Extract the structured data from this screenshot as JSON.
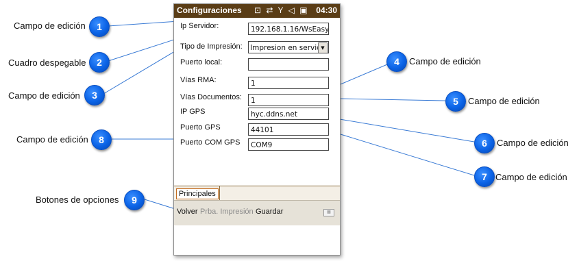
{
  "window": {
    "title": "Configuraciones",
    "status_icons": "⊡ ⇄ Y ◁ ▣",
    "time": "04:30"
  },
  "fields": [
    {
      "label": "Ip Servidor:",
      "value": "192.168.1.16/WsEasy"
    },
    {
      "label": "Tipo de Impresión:",
      "value": "Impresion en servido",
      "type": "select"
    },
    {
      "label": "Puerto local:",
      "value": ""
    },
    {
      "label": "Vías RMA:",
      "value": "1"
    },
    {
      "label": "Vías Documentos:",
      "value": "1"
    },
    {
      "label": "IP GPS",
      "value": "hyc.ddns.net"
    },
    {
      "label": "Puerto GPS",
      "value": "44101"
    },
    {
      "label": "Puerto COM GPS",
      "value": "COM9"
    }
  ],
  "tabs": [
    {
      "label": "Principales"
    }
  ],
  "menu": {
    "volver": "Volver",
    "prueba": "Prba. Impresión",
    "guardar": "Guardar"
  },
  "callouts": [
    {
      "num": "1",
      "label": "Campo de edición"
    },
    {
      "num": "2",
      "label": "Cuadro despegable"
    },
    {
      "num": "3",
      "label": "Campo de edición"
    },
    {
      "num": "4",
      "label": "Campo de edición"
    },
    {
      "num": "5",
      "label": "Campo de edición"
    },
    {
      "num": "6",
      "label": "Campo de edición"
    },
    {
      "num": "7",
      "label": "Campo de edición"
    },
    {
      "num": "8",
      "label": "Campo de edición"
    },
    {
      "num": "9",
      "label": "Botones de opciones"
    }
  ],
  "colors": {
    "titlebar": "#5a3d16",
    "badge": "#0b63e6",
    "callout_line": "#3a7bd5",
    "menubar": "#e6e2d8",
    "disabled_menu": "#8a8a8a"
  }
}
